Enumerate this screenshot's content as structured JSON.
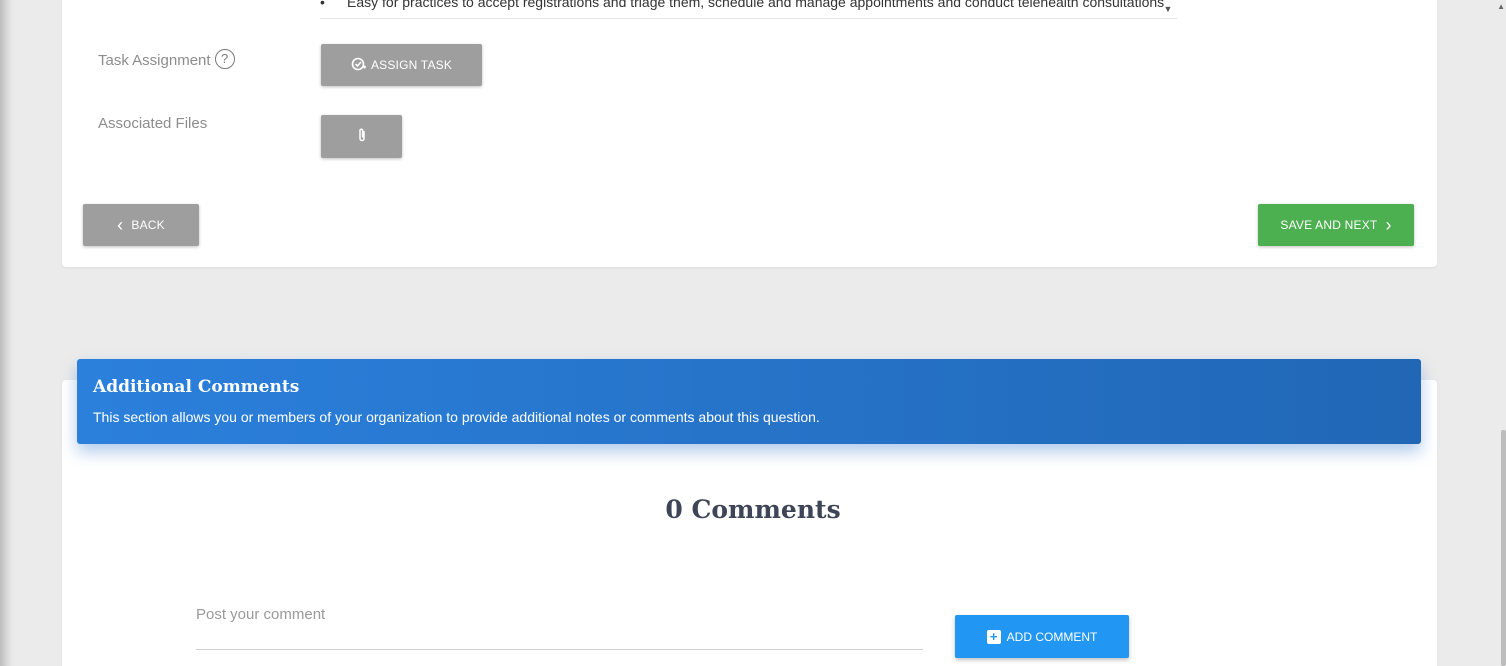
{
  "question_card": {
    "description": {
      "bullet": "•",
      "text": "Easy for practices to accept registrations and triage them, schedule and manage appointments and conduct telehealth consultations",
      "dropdown_icon": "caret-down-icon"
    },
    "task_assignment": {
      "label": "Task Assignment",
      "help_icon": "?",
      "button_label": "ASSIGN TASK",
      "button_icon": "task-check-icon"
    },
    "associated_files": {
      "label": "Associated Files",
      "button_icon": "paperclip-icon"
    },
    "back_button": {
      "icon": "‹",
      "label": "BACK"
    },
    "save_next_button": {
      "label": "SAVE AND NEXT",
      "icon": "›"
    },
    "colors": {
      "gray_button": "#9e9e9e",
      "green_button": "#4caf50"
    }
  },
  "additional_comments": {
    "title": "Additional Comments",
    "subtitle": "This section allows you or members of your organization to provide additional notes or comments about this question.",
    "count_label": "0 Comments",
    "input_placeholder": "Post your comment",
    "add_button": {
      "icon": "+",
      "label": "ADD COMMENT"
    },
    "colors": {
      "header": "#2575d0",
      "add_button": "#2196f3"
    }
  }
}
